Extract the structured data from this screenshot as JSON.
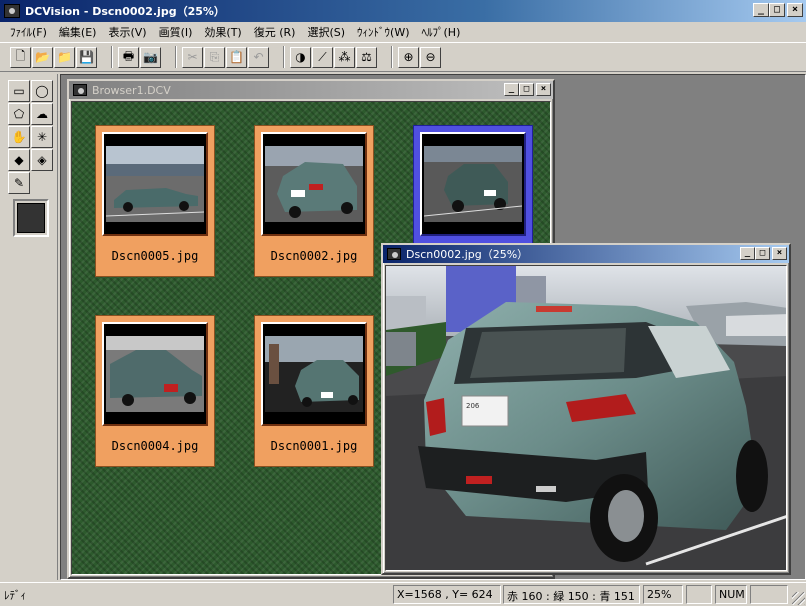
{
  "app": {
    "title": "DCVision - Dscn0002.jpg（25%）",
    "window_buttons": [
      "_",
      "□",
      "×"
    ]
  },
  "menu": [
    {
      "label": "ﾌｧｲﾙ(F)"
    },
    {
      "label": "編集(E)"
    },
    {
      "label": "表示(V)"
    },
    {
      "label": "画質(I)"
    },
    {
      "label": "効果(T)"
    },
    {
      "label": "復元 (R)"
    },
    {
      "label": "選択(S)"
    },
    {
      "label": "ｳｨﾝﾄﾞｳ(W)"
    },
    {
      "label": "ﾍﾙﾌﾟ(H)"
    }
  ],
  "toolbar": {
    "groups": [
      [
        {
          "icon": "new-file-icon",
          "glyph": "🗋"
        },
        {
          "icon": "open-folder-icon",
          "glyph": "📂"
        },
        {
          "icon": "open-file-icon",
          "glyph": "📁"
        },
        {
          "icon": "save-icon",
          "glyph": "💾"
        }
      ],
      [
        {
          "icon": "print-icon",
          "glyph": "🖶"
        },
        {
          "icon": "camera-icon",
          "glyph": "📷"
        }
      ],
      [
        {
          "icon": "cut-icon",
          "glyph": "✂",
          "disabled": true
        },
        {
          "icon": "copy-icon",
          "glyph": "⎘",
          "disabled": true
        },
        {
          "icon": "paste-icon",
          "glyph": "📋",
          "disabled": true
        },
        {
          "icon": "undo-icon",
          "glyph": "↶",
          "disabled": true
        }
      ],
      [
        {
          "icon": "contrast-icon",
          "glyph": "◑"
        },
        {
          "icon": "tone-curve-icon",
          "glyph": "⟋"
        },
        {
          "icon": "rgb-balance-icon",
          "glyph": "⁂"
        },
        {
          "icon": "levels-icon",
          "glyph": "⚖"
        }
      ],
      [
        {
          "icon": "zoom-in-icon",
          "glyph": "⊕"
        },
        {
          "icon": "zoom-out-icon",
          "glyph": "⊖"
        }
      ]
    ]
  },
  "palette": [
    {
      "icon": "rect-select-icon",
      "glyph": "▭"
    },
    {
      "icon": "ellipse-select-icon",
      "glyph": "◯"
    },
    {
      "icon": "polygon-select-icon",
      "glyph": "⬠"
    },
    {
      "icon": "lasso-select-icon",
      "glyph": "☁"
    },
    {
      "icon": "hand-pan-icon",
      "glyph": "✋"
    },
    {
      "icon": "magic-wand-icon",
      "glyph": "✳"
    },
    {
      "icon": "fill-bucket-icon",
      "glyph": "◆"
    },
    {
      "icon": "color-fill-icon",
      "glyph": "◈"
    },
    {
      "icon": "eyedropper-icon",
      "glyph": "✎"
    }
  ],
  "colors": {
    "current_color": "#333333"
  },
  "browser": {
    "title": "Browser1.DCV",
    "thumbnails": [
      {
        "label": "Dscn0005.jpg",
        "selected": false
      },
      {
        "label": "Dscn0002.jpg",
        "selected": false
      },
      {
        "label": "",
        "selected": true
      },
      {
        "label": "Dscn0004.jpg",
        "selected": false
      },
      {
        "label": "Dscn0001.jpg",
        "selected": false
      }
    ]
  },
  "viewer": {
    "title": "Dscn0002.jpg（25%）"
  },
  "status": {
    "ready": "ﾚﾃﾞｨ",
    "coords": "X=1568 , Y= 624",
    "rgb": "赤 160 : 緑 150 : 青 151",
    "zoom": "25%",
    "num": "NUM"
  }
}
